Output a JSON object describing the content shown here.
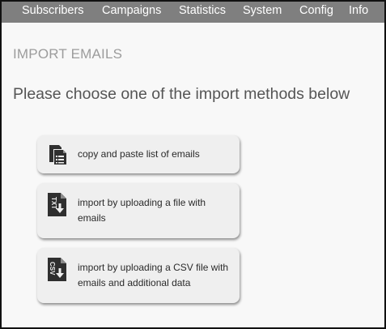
{
  "nav": {
    "items": [
      {
        "label": "Subscribers"
      },
      {
        "label": "Campaigns"
      },
      {
        "label": "Statistics"
      },
      {
        "label": "System"
      },
      {
        "label": "Config"
      },
      {
        "label": "Info"
      }
    ]
  },
  "page": {
    "heading": "IMPORT EMAILS",
    "subheading": "Please choose one of the import methods below"
  },
  "import_options": [
    {
      "label": "copy and paste list of emails",
      "icon": "paste-list-icon"
    },
    {
      "label": "import by uploading a file with emails",
      "icon": "txt-file-upload-icon",
      "icon_text": "TXT"
    },
    {
      "label": "import by uploading a CSV file with emails and additional data",
      "icon": "csv-file-upload-icon",
      "icon_text": "CSV"
    }
  ],
  "colors": {
    "navbar": "#7f7f7f",
    "nav_text": "#ffffff",
    "background": "#f8f8f8",
    "heading": "#9c9c9c",
    "subheading": "#555555",
    "card": "#efefef",
    "icon": "#2f2f2f"
  }
}
